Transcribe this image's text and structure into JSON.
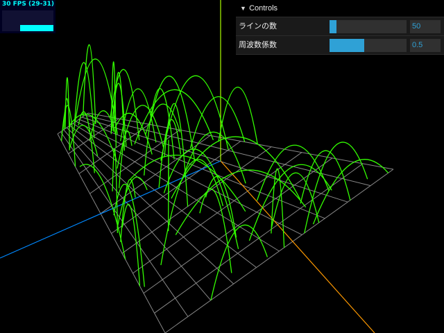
{
  "stats": {
    "text": "30 FPS (29-31)",
    "fps": 30,
    "min": 29,
    "max": 31
  },
  "controls": {
    "title": "Controls",
    "collapse_icon": "chevron-down-icon",
    "params": [
      {
        "label": "ラインの数",
        "value": "50",
        "slider_fraction": 0.09
      },
      {
        "label": "周波数係数",
        "value": "0.5",
        "slider_fraction": 0.45
      }
    ]
  },
  "scene": {
    "background": "#000000",
    "grid_color": "#888888",
    "line_color": "#33ff00",
    "axis_colors": {
      "x": "#ff9900",
      "y": "#aaff00",
      "z": "#0088ff"
    },
    "line_count": 50
  },
  "colors": {
    "accent": "#2fa1d6",
    "panel": "#1a1a1a",
    "stats_fg": "#00ffff"
  }
}
